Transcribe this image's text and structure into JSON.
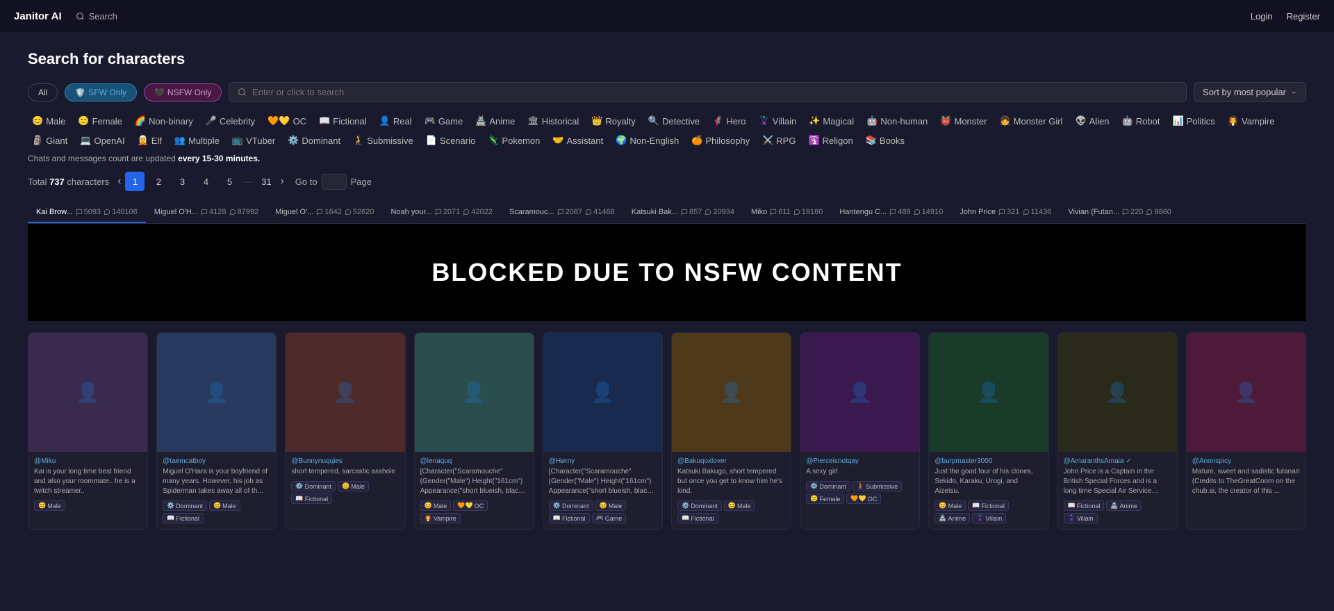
{
  "header": {
    "logo": "Janitor AI",
    "search_placeholder": "Search",
    "login": "Login",
    "register": "Register"
  },
  "page": {
    "title": "Search for characters",
    "filter_all": "All",
    "filter_sfw": "SFW Only",
    "filter_nsfw": "NSFW Only",
    "search_placeholder": "Enter or click to search",
    "sort_label": "Sort by most popular"
  },
  "tags": [
    {
      "emoji": "😊",
      "label": "Male"
    },
    {
      "emoji": "🙂",
      "label": "Female"
    },
    {
      "emoji": "🌈",
      "label": "Non-binary"
    },
    {
      "emoji": "🎤",
      "label": "Celebrity"
    },
    {
      "emoji": "🧡💛",
      "label": "OC"
    },
    {
      "emoji": "📖",
      "label": "Fictional"
    },
    {
      "emoji": "👤",
      "label": "Real"
    },
    {
      "emoji": "🎮",
      "label": "Game"
    },
    {
      "emoji": "🏯",
      "label": "Anime"
    },
    {
      "emoji": "🏛",
      "label": "Historical"
    },
    {
      "emoji": "👑",
      "label": "Royalty"
    },
    {
      "emoji": "🔍",
      "label": "Detective"
    },
    {
      "emoji": "🦸",
      "label": "Hero"
    },
    {
      "emoji": "🦹",
      "label": "Villain"
    },
    {
      "emoji": "✨",
      "label": "Magical"
    },
    {
      "emoji": "🤖",
      "label": "Non-human"
    },
    {
      "emoji": "👹",
      "label": "Monster"
    },
    {
      "emoji": "👧",
      "label": "Monster Girl"
    },
    {
      "emoji": "👽",
      "label": "Alien"
    },
    {
      "emoji": "🤖",
      "label": "Robot"
    },
    {
      "emoji": "📊",
      "label": "Politics"
    },
    {
      "emoji": "🧛",
      "label": "Vampire"
    },
    {
      "emoji": "🗿",
      "label": "Giant"
    },
    {
      "emoji": "💻",
      "label": "OpenAI"
    },
    {
      "emoji": "🧝",
      "label": "Elf"
    },
    {
      "emoji": "👥",
      "label": "Multiple"
    },
    {
      "emoji": "📺",
      "label": "VTuber"
    },
    {
      "emoji": "⚙️",
      "label": "Dominant"
    },
    {
      "emoji": "🧎",
      "label": "Submissive"
    },
    {
      "emoji": "📄",
      "label": "Scenario"
    },
    {
      "emoji": "🦎",
      "label": "Pokemon"
    },
    {
      "emoji": "🤝",
      "label": "Assistant"
    },
    {
      "emoji": "🌍",
      "label": "Non-English"
    },
    {
      "emoji": "🍊",
      "label": "Philosophy"
    },
    {
      "emoji": "⚔️",
      "label": "RPG"
    },
    {
      "emoji": "🛐",
      "label": "Religon"
    },
    {
      "emoji": "📚",
      "label": "Books"
    }
  ],
  "info": {
    "text": "Chats and messages count are updated",
    "highlight": "every 15-30 minutes."
  },
  "pagination": {
    "total_label": "Total",
    "total_count": "737",
    "chars_label": "characters",
    "pages": [
      "1",
      "2",
      "3",
      "4",
      "5",
      "31"
    ],
    "active_page": "1",
    "go_to_label": "Go to",
    "page_label": "Page"
  },
  "char_tabs": [
    {
      "name": "Kai Brow...",
      "chats": "5093",
      "msgs": "140106"
    },
    {
      "name": "Miguel O'H...",
      "chats": "4128",
      "msgs": "87992"
    },
    {
      "name": "Miguel O'...",
      "chats": "1642",
      "msgs": "52620"
    },
    {
      "name": "Noah your...",
      "chats": "2071",
      "msgs": "42022"
    },
    {
      "name": "Scaramouc...",
      "chats": "2087",
      "msgs": "41468"
    },
    {
      "name": "Katsuki Bak...",
      "chats": "857",
      "msgs": "20934"
    },
    {
      "name": "Miko",
      "chats": "611",
      "msgs": "19180"
    },
    {
      "name": "Hantengu C...",
      "chats": "489",
      "msgs": "14910"
    },
    {
      "name": "John Price",
      "chats": "321",
      "msgs": "11436"
    },
    {
      "name": "Vivian (Futan...",
      "chats": "220",
      "msgs": "9860"
    }
  ],
  "blocked_text": "BLOCKED DUE TO NSFW CONTENT",
  "cards": [
    {
      "author": "@Miku",
      "desc": "Kai is your long time best friend and also your roommate.. he is a twitch streamer..",
      "tags": [
        {
          "emoji": "😊",
          "label": "Male"
        }
      ],
      "avatar_color": "#3a2a4e"
    },
    {
      "author": "@taemcatboy",
      "desc": "Miguel O'Hara is your boyfriend of many years. However, his job as Spiderman takes away all of th...",
      "tags": [
        {
          "emoji": "⚙️",
          "label": "Dominant"
        },
        {
          "emoji": "😊",
          "label": "Male"
        },
        {
          "emoji": "📖",
          "label": "Fictional"
        }
      ],
      "avatar_color": "#2a3a5e"
    },
    {
      "author": "@Bunnynuqqies",
      "desc": "short tempered, sarcastic asshole",
      "tags": [
        {
          "emoji": "⚙️",
          "label": "Dominant"
        },
        {
          "emoji": "😊",
          "label": "Male"
        },
        {
          "emoji": "📖",
          "label": "Fictional"
        }
      ],
      "avatar_color": "#4e2a2a"
    },
    {
      "author": "@lenaquq",
      "desc": "[Character(\"Scaramouche\" (Gender(\"Male\") Height(\"161cm\") Appearance(\"short blueish, black hai...",
      "tags": [
        {
          "emoji": "😊",
          "label": "Male"
        },
        {
          "emoji": "🧡💛",
          "label": "OC"
        },
        {
          "emoji": "🧛",
          "label": "Vampire"
        }
      ],
      "avatar_color": "#2a4e4e"
    },
    {
      "author": "@Hørny",
      "desc": "[Character(\"Scaramouche\" (Gender(\"Male\") Height(\"161cm\") Appearance(\"short blueish, black hai...",
      "tags": [
        {
          "emoji": "⚙️",
          "label": "Dominant"
        },
        {
          "emoji": "😊",
          "label": "Male"
        },
        {
          "emoji": "📖",
          "label": "Fictional"
        },
        {
          "emoji": "🎮",
          "label": "Game"
        }
      ],
      "avatar_color": "#1a2a4e"
    },
    {
      "author": "@Bakuqoxlover",
      "desc": "Katsuki Bakugo, short tempered but once you get to know him he's kind.",
      "tags": [
        {
          "emoji": "⚙️",
          "label": "Dominant"
        },
        {
          "emoji": "😊",
          "label": "Male"
        },
        {
          "emoji": "📖",
          "label": "Fictional"
        }
      ],
      "avatar_color": "#4e3a1a"
    },
    {
      "author": "@Pierceisnotqay",
      "desc": "A sexy girl",
      "tags": [
        {
          "emoji": "⚙️",
          "label": "Dominant"
        },
        {
          "emoji": "🧎",
          "label": "Submissive"
        },
        {
          "emoji": "🙂",
          "label": "Female"
        },
        {
          "emoji": "🧡💛",
          "label": "OC"
        }
      ],
      "avatar_color": "#3a1a4e"
    },
    {
      "author": "@burpmaster3000",
      "desc": "Just the good four of his clones, Sekido, Karaku, Urogi, and Aizetsu.",
      "tags": [
        {
          "emoji": "😊",
          "label": "Male"
        },
        {
          "emoji": "📖",
          "label": "Fictional"
        },
        {
          "emoji": "🏯",
          "label": "Anime"
        },
        {
          "emoji": "🦹",
          "label": "Villain"
        }
      ],
      "avatar_color": "#1a3a2a"
    },
    {
      "author": "@AmaranthsAmaia ✓",
      "desc": "John Price is a Captain in the British Special Forces and is a long time Special Air Service memb...",
      "tags": [
        {
          "emoji": "📖",
          "label": "Fictional"
        },
        {
          "emoji": "🏯",
          "label": "Anime"
        },
        {
          "emoji": "🦹",
          "label": "Villain"
        }
      ],
      "avatar_color": "#2a2a1a"
    },
    {
      "author": "@Anonspicy",
      "desc": "Mature, sweet and sadistic futanari (Credits to TheGreatCoom on the chub.ai, the creator of this ...",
      "tags": [],
      "avatar_color": "#4e1a3a"
    }
  ]
}
